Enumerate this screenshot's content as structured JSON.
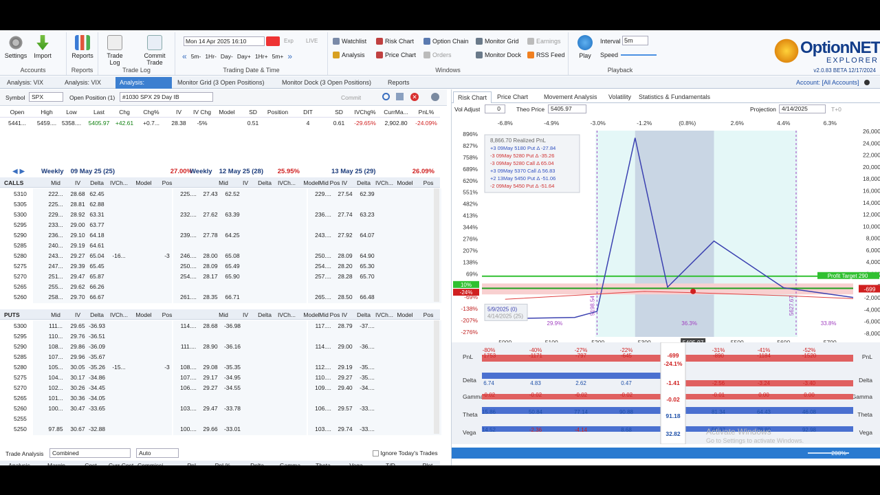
{
  "ribbon": {
    "settings": "Settings",
    "import": "Import",
    "accounts": "Accounts",
    "reports_btn": "Reports",
    "reports": "Reports",
    "trade_log_btn": "Trade Log",
    "commit_trade": "Commit Trade",
    "trade_log": "Trade Log",
    "date_value": "Mon 14 Apr 2025 16:10",
    "exp": "Exp",
    "live": "LIVE",
    "nav": [
      "5m-",
      "1Hr-",
      "Day-",
      "Day+",
      "1Hr+",
      "5m+"
    ],
    "trading_date_time": "Trading Date & Time",
    "watchlist": "Watchlist",
    "risk_chart": "Risk Chart",
    "option_chain": "Option Chain",
    "monitor_grid": "Monitor Grid",
    "earnings": "Earnings",
    "analysis": "Analysis",
    "price_chart": "Price Chart",
    "orders": "Orders",
    "monitor_dock": "Monitor Dock",
    "rss_feed": "RSS Feed",
    "windows": "Windows",
    "play": "Play",
    "interval_label": "Interval",
    "interval": "5m",
    "speed": "Speed",
    "playback": "Playback"
  },
  "logo": {
    "name": "OptionNET",
    "sub": "EXPLORER",
    "version": "v2.0.83 BETA 12/17/2024"
  },
  "tabs": [
    "Analysis: VIX",
    "Analysis: VIX",
    "Analysis: SPX",
    "Monitor Grid (3 Open Positions)",
    "Monitor Dock (3 Open Positions)",
    "Reports"
  ],
  "account": "Account: [All Accounts]",
  "symbol_bar": {
    "symbol_label": "Symbol",
    "symbol": "SPX",
    "open_pos_label": "Open Position (1)",
    "position": "#1030 SPX 29 Day IB",
    "commit": "Commit"
  },
  "quote": {
    "headers": [
      "Open",
      "High",
      "Low",
      "Last",
      "Chg",
      "Chg%",
      "IV",
      "IV Chg",
      "Model",
      "SD",
      "Position",
      "DIT",
      "SD",
      "IVChg%",
      "CurrMa...",
      "PnL%"
    ],
    "values": [
      "5441...",
      "5459....",
      "5358....",
      "5405.97",
      "+42.61",
      "+0.7...",
      "28.38",
      "-5%",
      "",
      "0.51",
      "",
      "4",
      "0.61",
      "-29.65%",
      "2,902.80",
      "-24.09%"
    ]
  },
  "expiries": [
    {
      "name": "Weekly",
      "date": "09 May 25 (25)",
      "iv": "27.00%"
    },
    {
      "name": "Weekly",
      "date": "12 May 25 (28)",
      "iv": "25.95%"
    },
    {
      "name": "",
      "date": "13 May 25 (29)",
      "iv": "26.09%"
    }
  ],
  "chain_cols": [
    "Mid",
    "IV",
    "Delta",
    "IVCh...",
    "Model",
    "Pos"
  ],
  "calls_label": "CALLS",
  "puts_label": "PUTS",
  "calls": [
    {
      "k": "5310",
      "a": [
        "222...",
        "28.68",
        "62.45",
        "",
        "",
        ""
      ],
      "b": [
        "225....",
        "27.43",
        "62.52"
      ],
      "c": [
        "229....",
        "27.54",
        "62.39"
      ]
    },
    {
      "k": "5305",
      "a": [
        "225...",
        "28.81",
        "62.88",
        "",
        "",
        ""
      ],
      "b": [
        "",
        "",
        ""
      ],
      "c": [
        "",
        "",
        ""
      ]
    },
    {
      "k": "5300",
      "a": [
        "229...",
        "28.92",
        "63.31",
        "",
        "",
        ""
      ],
      "b": [
        "232....",
        "27.62",
        "63.39"
      ],
      "c": [
        "236....",
        "27.74",
        "63.23"
      ]
    },
    {
      "k": "5295",
      "a": [
        "233...",
        "29.00",
        "63.77",
        "",
        "",
        ""
      ],
      "b": [
        "",
        "",
        ""
      ],
      "c": [
        "",
        "",
        ""
      ]
    },
    {
      "k": "5290",
      "a": [
        "236...",
        "29.10",
        "64.18",
        "",
        "",
        ""
      ],
      "b": [
        "239....",
        "27.78",
        "64.25"
      ],
      "c": [
        "243....",
        "27.92",
        "64.07"
      ]
    },
    {
      "k": "5285",
      "a": [
        "240...",
        "29.19",
        "64.61",
        "",
        "",
        ""
      ],
      "b": [
        "",
        "",
        ""
      ],
      "c": [
        "",
        "",
        ""
      ]
    },
    {
      "k": "5280",
      "a": [
        "243...",
        "29.27",
        "65.04",
        "-16...",
        "",
        "-3"
      ],
      "b": [
        "246....",
        "28.00",
        "65.08"
      ],
      "c": [
        "250....",
        "28.09",
        "64.90"
      ]
    },
    {
      "k": "5275",
      "a": [
        "247...",
        "29.39",
        "65.45",
        "",
        "",
        ""
      ],
      "b": [
        "250....",
        "28.09",
        "65.49"
      ],
      "c": [
        "254....",
        "28.20",
        "65.30"
      ]
    },
    {
      "k": "5270",
      "a": [
        "251...",
        "29.47",
        "65.87",
        "",
        "",
        ""
      ],
      "b": [
        "254....",
        "28.17",
        "65.90"
      ],
      "c": [
        "257....",
        "28.28",
        "65.70"
      ]
    },
    {
      "k": "5265",
      "a": [
        "255...",
        "29.62",
        "66.26",
        "",
        "",
        ""
      ],
      "b": [
        "",
        "",
        ""
      ],
      "c": [
        "",
        "",
        ""
      ]
    },
    {
      "k": "5260",
      "a": [
        "258...",
        "29.70",
        "66.67",
        "",
        "",
        ""
      ],
      "b": [
        "261....",
        "28.35",
        "66.71"
      ],
      "c": [
        "265....",
        "28.50",
        "66.48"
      ]
    }
  ],
  "puts": [
    {
      "k": "5300",
      "a": [
        "111...",
        "29.65",
        "-36.93",
        "",
        "",
        ""
      ],
      "b": [
        "114....",
        "28.68",
        "-36.98"
      ],
      "c": [
        "117....",
        "28.79",
        "-37...."
      ]
    },
    {
      "k": "5295",
      "a": [
        "110...",
        "29.76",
        "-36.51",
        "",
        "",
        ""
      ],
      "b": [
        "",
        "",
        ""
      ],
      "c": [
        "",
        "",
        ""
      ]
    },
    {
      "k": "5290",
      "a": [
        "108...",
        "29.86",
        "-36.09",
        "",
        "",
        ""
      ],
      "b": [
        "111....",
        "28.90",
        "-36.16"
      ],
      "c": [
        "114....",
        "29.00",
        "-36...."
      ]
    },
    {
      "k": "5285",
      "a": [
        "107...",
        "29.96",
        "-35.67",
        "",
        "",
        ""
      ],
      "b": [
        "",
        "",
        ""
      ],
      "c": [
        "",
        "",
        ""
      ]
    },
    {
      "k": "5280",
      "a": [
        "105...",
        "30.05",
        "-35.26",
        "-15...",
        "",
        "-3"
      ],
      "b": [
        "108....",
        "29.08",
        "-35.35"
      ],
      "c": [
        "112....",
        "29.19",
        "-35...."
      ]
    },
    {
      "k": "5275",
      "a": [
        "104...",
        "30.17",
        "-34.86",
        "",
        "",
        ""
      ],
      "b": [
        "107....",
        "29.17",
        "-34.95"
      ],
      "c": [
        "110....",
        "29.27",
        "-35...."
      ]
    },
    {
      "k": "5270",
      "a": [
        "102...",
        "30.26",
        "-34.45",
        "",
        "",
        ""
      ],
      "b": [
        "106....",
        "29.27",
        "-34.55"
      ],
      "c": [
        "109....",
        "29.40",
        "-34...."
      ]
    },
    {
      "k": "5265",
      "a": [
        "101...",
        "30.36",
        "-34.05",
        "",
        "",
        ""
      ],
      "b": [
        "",
        "",
        ""
      ],
      "c": [
        "",
        "",
        ""
      ]
    },
    {
      "k": "5260",
      "a": [
        "100...",
        "30.47",
        "-33.65",
        "",
        "",
        ""
      ],
      "b": [
        "103....",
        "29.47",
        "-33.78"
      ],
      "c": [
        "106....",
        "29.57",
        "-33...."
      ]
    },
    {
      "k": "5255",
      "a": [
        "",
        "",
        "",
        "",
        "",
        ""
      ],
      "b": [
        "",
        "",
        ""
      ],
      "c": [
        "",
        "",
        ""
      ]
    },
    {
      "k": "5250",
      "a": [
        "97.85",
        "30.67",
        "-32.88",
        "",
        "",
        ""
      ],
      "b": [
        "100....",
        "29.66",
        "-33.01"
      ],
      "c": [
        "103....",
        "29.74",
        "-33...."
      ]
    }
  ],
  "trade_analysis": {
    "label": "Trade Analysis",
    "mode": "Combined",
    "auto": "Auto",
    "ignore": "Ignore Today's Trades",
    "headers": [
      "Analysis",
      "Margin",
      "Cost",
      "Curr Cost",
      "Commissi...",
      "PnL",
      "PnL%",
      "Delta",
      "Gamma",
      "Theta",
      "Vega",
      "T/D",
      "Plot"
    ],
    "position": [
      "Position",
      "2,902.80",
      "23,925.70",
      "-24,625....",
      "14.30",
      "-699.30",
      "-24.09%",
      "-1.41",
      "-0.02",
      "91.16",
      "32.82",
      "64.7",
      ""
    ],
    "model": [
      "Model",
      "",
      "",
      "",
      "",
      "0.00",
      "0.00",
      "0.00",
      "0.00",
      "0.00",
      "0.00",
      "0",
      ""
    ]
  },
  "risk_tabs": [
    "Risk Chart",
    "Price Chart",
    "Movement Analysis",
    "Volatility",
    "Statistics & Fundamentals"
  ],
  "risk_ctrl": {
    "vol_adjust": "Vol Adjust",
    "vol_value": "0",
    "theo_price": "Theo Price",
    "theo_value": "5405.97",
    "projection": "Projection",
    "proj_value": "4/14/2025",
    "t0": "T+0"
  },
  "pct_labels": [
    "-6.8%",
    "-4.9%",
    "-3.0%",
    "-1.2%",
    "(0.8%)",
    "2.6%",
    "4.4%",
    "6.3%"
  ],
  "left_axis": [
    "896%",
    "827%",
    "758%",
    "689%",
    "620%",
    "551%",
    "482%",
    "413%",
    "344%",
    "276%",
    "207%",
    "138%",
    "69%",
    "0%",
    "-69%",
    "-138%",
    "-207%",
    "-276%"
  ],
  "right_axis": [
    "26,000",
    "24,000",
    "22,000",
    "20,000",
    "18,000",
    "16,000",
    "14,000",
    "12,000",
    "10,000",
    "8,000",
    "6,000",
    "4,000",
    "2,000",
    "0",
    "-2,000",
    "-4,000",
    "-6,000",
    "-8,000"
  ],
  "x_axis": [
    "5000",
    "5100",
    "5200",
    "5300",
    "5400",
    "5500",
    "5600",
    "5700"
  ],
  "x_current": "5405.97",
  "legend": {
    "title": "8,866.70 Realized PnL",
    "items": [
      {
        "t": "+3  09May 5180 Put Δ  -27.84",
        "c": "#3050c0"
      },
      {
        "t": "-3  09May 5280 Put Δ  -35.26",
        "c": "#d03030"
      },
      {
        "t": "-3  09May 5280 Call Δ  65.04",
        "c": "#d03030"
      },
      {
        "t": "+3  09May 5370 Call Δ  56.83",
        "c": "#3050c0"
      },
      {
        "t": "+2  13May 5450 Put Δ  -51.06",
        "c": "#3050c0"
      },
      {
        "t": "-2  09May 5450 Put Δ  -51.64",
        "c": "#d03030"
      }
    ]
  },
  "chart_labels": {
    "date1": "5/9/2025 (0)",
    "date2": "4/14/2025 (25)",
    "be1": "5198.54",
    "be2": "5627.67",
    "pct_left": "29.9%",
    "pct_mid": "36.3%",
    "pct_right": "33.8%",
    "profit_target": "Profit Target 290",
    "pnl_right": "-699",
    "pct_10": "10%",
    "pct_neg24": "-24%"
  },
  "greeks": {
    "labels": [
      "PnL",
      "Delta",
      "Gamma",
      "Theta",
      "Vega"
    ],
    "pnl_pct": [
      "-80%",
      "-40%",
      "-27%",
      "-22%",
      "",
      "-31%",
      "-41%",
      "-52%"
    ],
    "pnl": [
      "-1753",
      "-1171",
      "-797",
      "-645",
      "",
      "-890",
      "-1184",
      "-1520"
    ],
    "current": {
      "pnl": "-699",
      "pnl_pct": "-24.1%",
      "delta": "-1.41",
      "gamma": "-0.02",
      "theta": "91.18",
      "vega": "32.82"
    },
    "delta": [
      "6.74",
      "4.83",
      "2.62",
      "0.47",
      "",
      "-2.56",
      "-3.24",
      "-3.40"
    ],
    "gamma": [
      "-0.02",
      "-0.02",
      "-0.02",
      "-0.02",
      "",
      "-0.01",
      "0.00",
      "0.00"
    ],
    "theta": [
      "15.86",
      "50.84",
      "77.14",
      "90.88",
      "",
      "81.34",
      "64.43",
      "46.08"
    ],
    "vega": [
      "14.52",
      "-2.36",
      "-4.14",
      "8.68",
      "",
      "56.97",
      "78.80",
      "92.98"
    ]
  },
  "watermark": {
    "l1": "Activate Windows",
    "l2": "Go to Settings to activate Windows."
  },
  "zoom": "200%"
}
